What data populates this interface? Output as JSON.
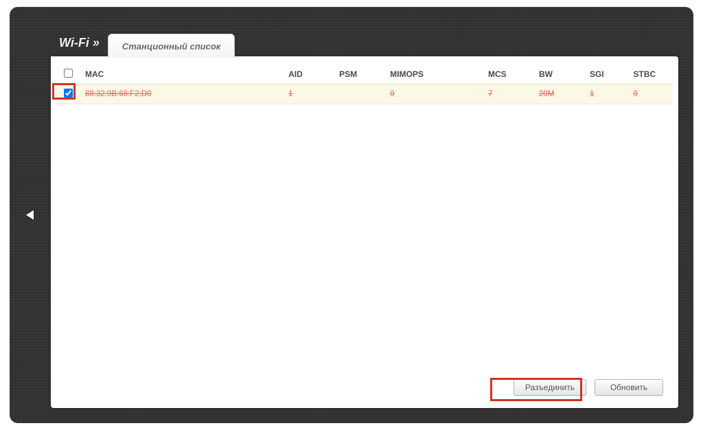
{
  "header": {
    "section": "Wi-Fi »",
    "tab": "Станционный список"
  },
  "table": {
    "columns": {
      "mac": "MAC",
      "aid": "AID",
      "psm": "PSM",
      "mimops": "MIMOPS",
      "mcs": "MCS",
      "bw": "BW",
      "sgi": "SGI",
      "stbc": "STBC"
    },
    "rows": [
      {
        "checked": true,
        "mac": "88:32:9B:68:F2:D0",
        "aid": "1",
        "psm": "",
        "mimops": "0",
        "mcs": "7",
        "bw": "20M",
        "sgi": "1",
        "stbc": "0"
      }
    ]
  },
  "buttons": {
    "disconnect": "Разъединить",
    "refresh": "Обновить"
  }
}
